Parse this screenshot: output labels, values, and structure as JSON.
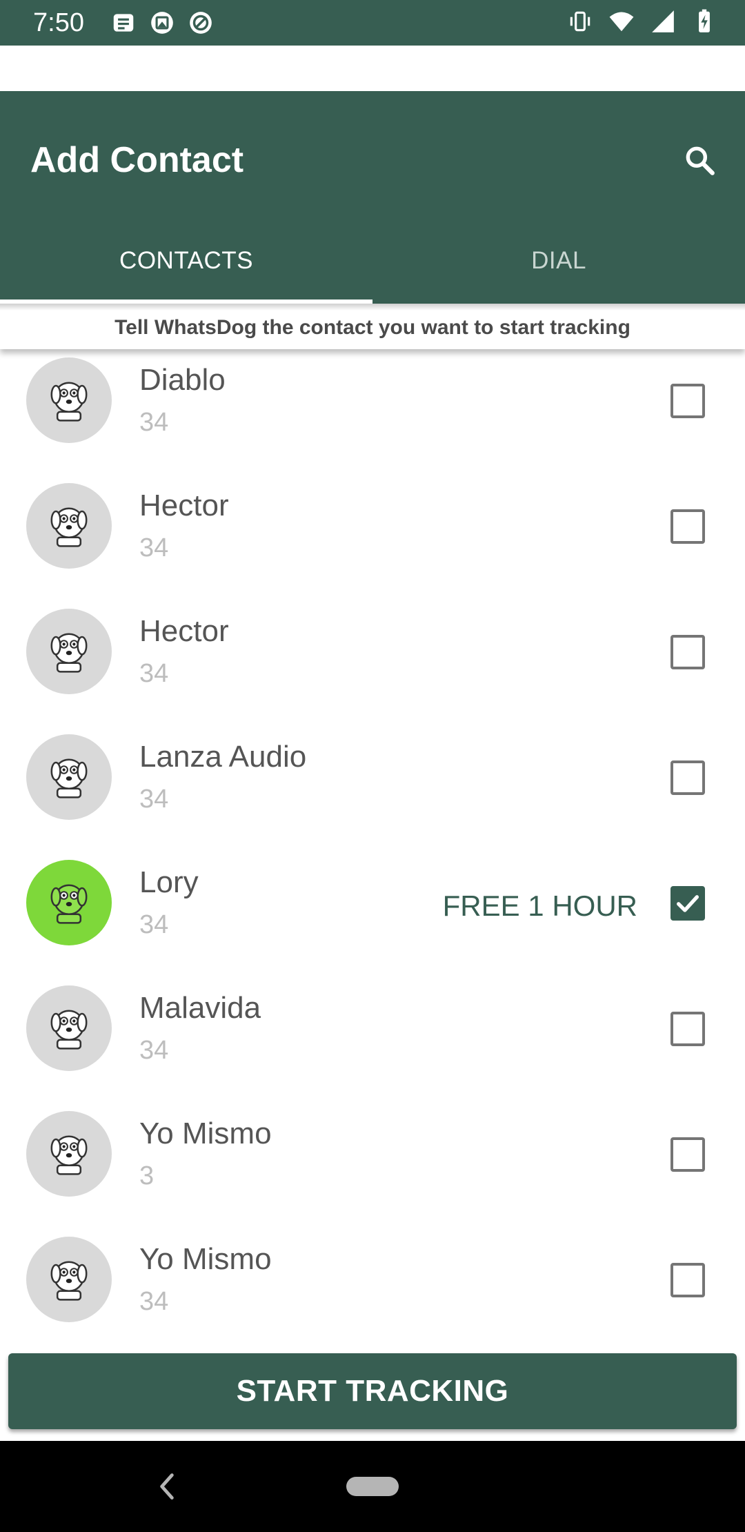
{
  "status_bar": {
    "time": "7:50",
    "left_icons": [
      "notes-icon",
      "gallery-icon",
      "at-sign-icon"
    ],
    "right_icons": [
      "vibrate-icon",
      "wifi-icon",
      "signal-icon",
      "battery-charging-icon"
    ]
  },
  "app_bar": {
    "title": "Add Contact",
    "search_icon": "search-icon"
  },
  "tabs": [
    {
      "label": "CONTACTS",
      "active": true
    },
    {
      "label": "DIAL",
      "active": false
    }
  ],
  "hint": "Tell WhatsDog the contact you want to start tracking",
  "contacts": [
    {
      "name": "Diablo",
      "phone": "34",
      "checked": false,
      "badge": ""
    },
    {
      "name": "Hector",
      "phone": "34",
      "checked": false,
      "badge": ""
    },
    {
      "name": "Hector",
      "phone": "34",
      "checked": false,
      "badge": ""
    },
    {
      "name": "Lanza Audio",
      "phone": "34",
      "checked": false,
      "badge": ""
    },
    {
      "name": "Lory",
      "phone": "34",
      "checked": true,
      "badge": "FREE 1 HOUR"
    },
    {
      "name": "Malavida",
      "phone": "34",
      "checked": false,
      "badge": ""
    },
    {
      "name": "Yo Mismo",
      "phone": "3",
      "checked": false,
      "badge": ""
    },
    {
      "name": "Yo Mismo",
      "phone": "34",
      "checked": false,
      "badge": ""
    }
  ],
  "start_button": "START TRACKING",
  "colors": {
    "primary": "#375e52",
    "avatar_default": "#d9d9d9",
    "avatar_selected": "#7ed83a"
  },
  "nav_bar": {
    "back_icon": "back-chevron-icon",
    "home_icon": "home-pill-icon"
  }
}
